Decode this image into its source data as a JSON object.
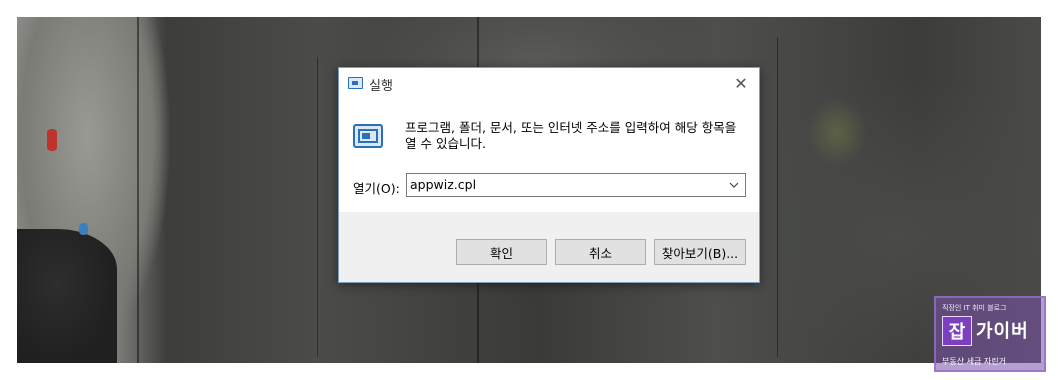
{
  "dialog": {
    "title": "실행",
    "close_glyph": "✕",
    "prompt": "프로그램, 폴더, 문서, 또는 인터넷 주소를 입력하여 해당 항목을 열 수 있습니다.",
    "open_label": "열기(O):",
    "open_value": "appwiz.cpl",
    "ok_label": "확인",
    "cancel_label": "취소",
    "browse_label": "찾아보기(B)..."
  },
  "watermark": {
    "top_text": "직장인 IT 취미 블로그",
    "logo_char": "잡",
    "main_text": "가이버",
    "bottom_text": "부동산 세금 자린거"
  },
  "icons": {
    "title_icon": "run-icon",
    "content_icon": "run-icon",
    "dropdown": "chevron-down-icon"
  },
  "colors": {
    "dialog_border": "#7d9ec0",
    "footer_bg": "#f0f0f0",
    "button_bg": "#e1e1e1",
    "icon_blue": "#2a6fb8"
  }
}
